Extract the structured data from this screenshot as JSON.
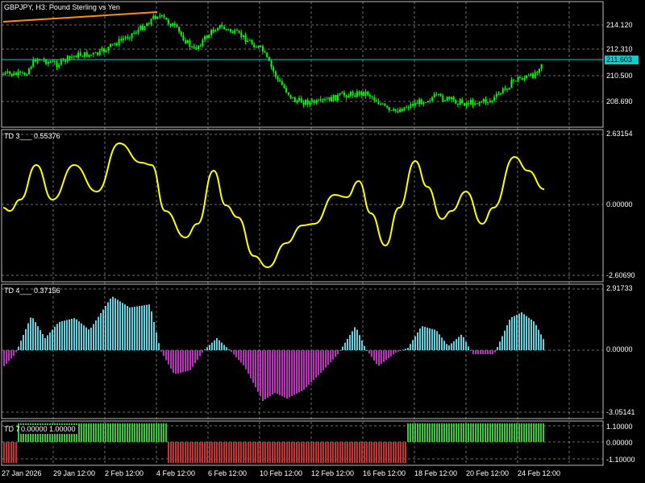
{
  "window": {
    "symbol_title": "GBPJPY, H3:  Pound Sterling vs Yen",
    "current_price": "211.603"
  },
  "panes": {
    "main": {
      "price_ticks": [
        "214.120",
        "212.310",
        "210.500",
        "208.690"
      ]
    },
    "td3": {
      "label": "TD 3___",
      "value": "0.55376",
      "scale_ticks": [
        "2.63154",
        "0.00000",
        "-2.60690"
      ]
    },
    "td4": {
      "label": "TD 4___",
      "value": "0.37156",
      "scale_ticks": [
        "2.91733",
        "0.00000",
        "-3.05141"
      ]
    },
    "td7": {
      "label": "TD 7___",
      "values": "0.00000 1.00000",
      "scale_ticks": [
        "1.10000",
        "0.00000",
        "-1.10000"
      ]
    }
  },
  "time_axis": [
    "27 Jan 2026",
    "29 Jan 12:00",
    "2 Feb 12:00",
    "4 Feb 12:00",
    "6 Feb 12:00",
    "10 Feb 12:00",
    "12 Feb 12:00",
    "16 Feb 12:00",
    "18 Feb 12:00",
    "20 Feb 12:00",
    "24 Feb 12:00"
  ],
  "colors": {
    "background": "#000000",
    "grid": "#c8c8c8",
    "candle": "#00ff00",
    "price_line": "#00d2d2",
    "trend_line": "#ff8c1a",
    "td3_line": "#ffff00",
    "td4_positive": "#5fd3e0",
    "td4_negative": "#c030c0",
    "td7_positive": "#3cc83c",
    "td7_negative": "#c83232"
  }
}
